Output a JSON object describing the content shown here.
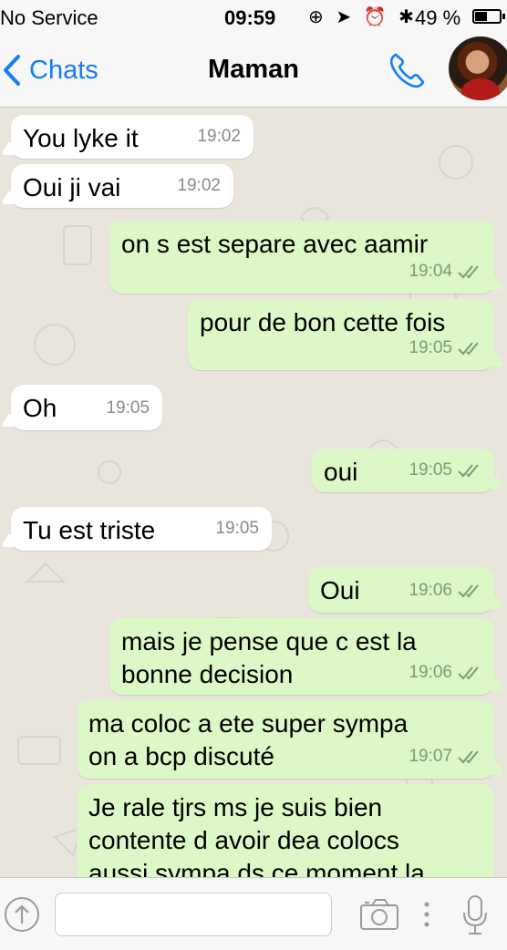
{
  "status_bar": {
    "carrier": "No Service",
    "time": "09:59",
    "icons": "⊕ ➤ ⏰ ✱",
    "battery_percent": "49 %",
    "battery_level": 0.49
  },
  "nav": {
    "back_label": "Chats",
    "title": "Maman",
    "call_icon": "phone-icon",
    "avatar_icon": "contact-avatar"
  },
  "messages": [
    {
      "dir": "in",
      "text": "You lyke it",
      "time": "19:02"
    },
    {
      "dir": "in",
      "text": "Oui ji vai",
      "time": "19:02"
    },
    {
      "dir": "out",
      "text": "on s est separe avec aamir",
      "time": "19:04",
      "status": "read-double-check"
    },
    {
      "dir": "out",
      "text": "pour de bon cette fois",
      "time": "19:05",
      "status": "read-double-check"
    },
    {
      "dir": "in",
      "text": "Oh",
      "time": "19:05"
    },
    {
      "dir": "out",
      "text": "oui",
      "time": "19:05",
      "status": "read-double-check"
    },
    {
      "dir": "in",
      "text": "Tu est triste",
      "time": "19:05"
    },
    {
      "dir": "out",
      "text": "Oui",
      "time": "19:06",
      "status": "read-double-check"
    },
    {
      "dir": "out",
      "lines": [
        "mais je pense que c est la",
        "bonne decision"
      ],
      "time": "19:06",
      "status": "read-double-check"
    },
    {
      "dir": "out",
      "lines": [
        "ma coloc a ete super sympa",
        "on a bcp discuté"
      ],
      "time": "19:07",
      "status": "read-double-check"
    },
    {
      "dir": "out",
      "lines": [
        "Je rale tjrs ms je suis bien",
        "contente d avoir dea colocs",
        "aussi sympa ds ce moment la"
      ],
      "time": "",
      "status": ""
    }
  ],
  "input_bar": {
    "share_icon": "share-arrow-icon",
    "placeholder": "",
    "camera_icon": "camera-icon",
    "more_icon": "more-dots-icon",
    "mic_icon": "microphone-icon"
  },
  "colors": {
    "accent": "#127efb",
    "incoming_bubble": "#ffffff",
    "outgoing_bubble": "#dcf8c6",
    "chat_background": "#e9e4dc"
  }
}
